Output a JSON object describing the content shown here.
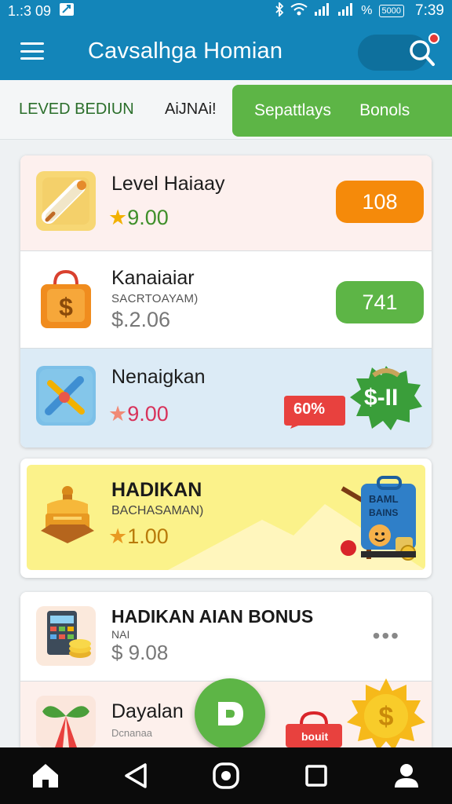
{
  "status_bar": {
    "time_left": "1.:3 09",
    "battery_label": "5000",
    "percent": "%",
    "clock": "7:39"
  },
  "app_bar": {
    "title": "Cavsalhga Homian",
    "menu_icon": "hamburger-menu-icon",
    "search_icon": "search-icon"
  },
  "tabs": [
    {
      "label": "LEVED BEDIUN"
    },
    {
      "label": "AiJNAi!"
    },
    {
      "label": "Sepattlays"
    },
    {
      "label": "Bonols"
    }
  ],
  "list1": {
    "items": [
      {
        "title": "Level Haiaay",
        "price": "9.00",
        "badge": "108",
        "badge_color": "#f58a0a",
        "icon": "rolled-scroll-icon"
      },
      {
        "title": "Kanaiaiar",
        "subtitle": "SACRTOAYAM)",
        "price": "$.2.06",
        "badge": "741",
        "badge_color": "#5db546",
        "icon": "shopping-bag-dollar-icon"
      },
      {
        "title": "Nenaigkan",
        "price": "9.00",
        "badge": "60%",
        "badge2": "$-II",
        "icon": "crossed-tools-icon"
      }
    ]
  },
  "promo": {
    "title": "HADIKAN",
    "subtitle": "BACHASAMAN)",
    "price": "1.00",
    "art_label_1": "BAML",
    "art_label_2": "BAINS",
    "icon": "treasure-chest-icon"
  },
  "list2": {
    "items": [
      {
        "title": "HADIKAN AIAN BONUS",
        "subtitle": "NAI",
        "price": "$ 9.08",
        "icon": "calculator-coins-icon",
        "more_icon": "more-dots-icon"
      },
      {
        "title": "Dayalan",
        "subtitle": "Dcnanaa",
        "icon": "gift-bow-icon",
        "bag_label": "bouit"
      }
    ]
  },
  "fab": {
    "label": "D"
  },
  "nav": [
    {
      "icon": "home-icon"
    },
    {
      "icon": "back-triangle-icon"
    },
    {
      "icon": "home-circle-icon"
    },
    {
      "icon": "recents-square-icon"
    },
    {
      "icon": "profile-icon"
    }
  ]
}
